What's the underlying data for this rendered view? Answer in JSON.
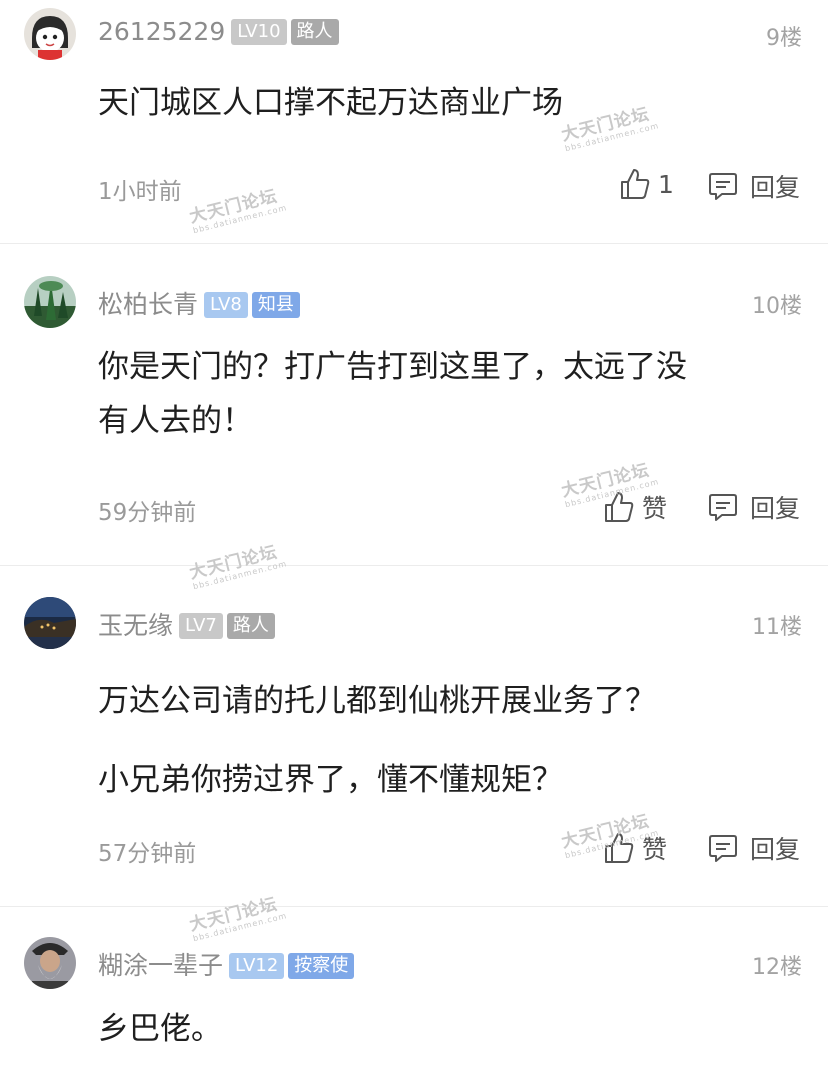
{
  "posts": [
    {
      "username": "26125229",
      "level": "LV10",
      "title": "路人",
      "floor": "9楼",
      "lines": [
        "天门城区人口撑不起万达商业广场"
      ],
      "time": "1小时前",
      "like_label": "1",
      "reply_label": "回复",
      "level_color": "#c8c8c8",
      "title_color": "#a9a9a9",
      "avatar": "cartoon-face-icon"
    },
    {
      "username": "松柏长青",
      "level": "LV8",
      "title": "知县",
      "floor": "10楼",
      "lines": [
        "你是天门的？打广告打到这里了，太远了没",
        "有人去的！"
      ],
      "time": "59分钟前",
      "like_label": "赞",
      "reply_label": "回复",
      "level_color": "#a8c8f0",
      "title_color": "#7fa8e8",
      "avatar": "landscape-photo-icon"
    },
    {
      "username": "玉无缘",
      "level": "LV7",
      "title": "路人",
      "floor": "11楼",
      "lines": [
        "万达公司请的托儿都到仙桃开展业务了？",
        "小兄弟你捞过界了，懂不懂规矩？"
      ],
      "time": "57分钟前",
      "like_label": "赞",
      "reply_label": "回复",
      "level_color": "#c8c8c8",
      "title_color": "#a9a9a9",
      "avatar": "night-coast-photo-icon"
    },
    {
      "username": "糊涂一辈子",
      "level": "LV12",
      "title": "按察使",
      "floor": "12楼",
      "lines": [
        "乡巴佬。"
      ],
      "level_color": "#a8c8f0",
      "title_color": "#7fa8e8",
      "avatar": "old-man-photo-icon"
    }
  ],
  "watermark": {
    "main": "大天门论坛",
    "sub": "bbs.datianmen.com"
  }
}
